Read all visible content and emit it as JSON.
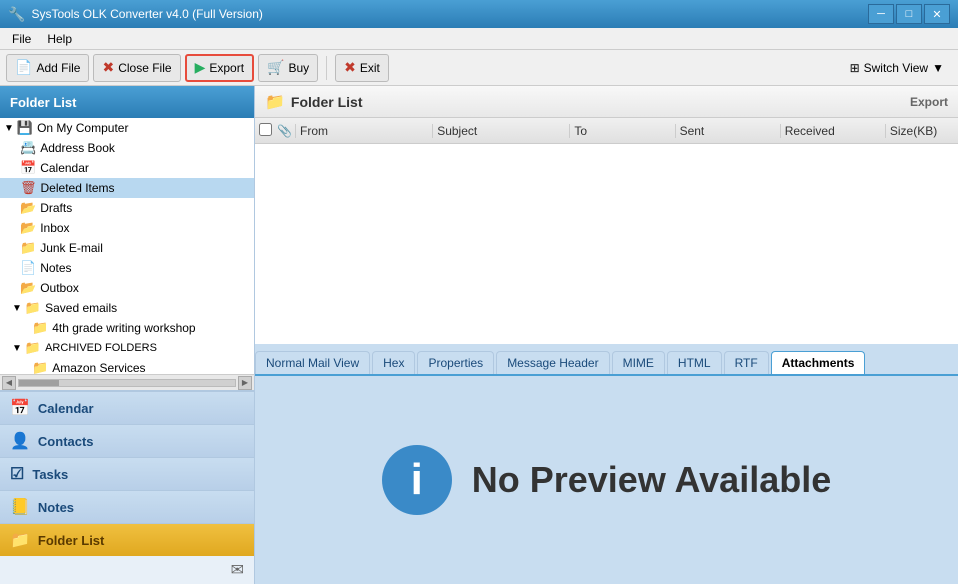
{
  "titleBar": {
    "title": "SysTools OLK Converter v4.0 (Full Version)",
    "controls": {
      "minimize": "─",
      "maximize": "□",
      "close": "✕"
    }
  },
  "menuBar": {
    "items": [
      "File",
      "Help"
    ]
  },
  "toolbar": {
    "addFile": "Add File",
    "closeFile": "Close File",
    "export": "Export",
    "buy": "Buy",
    "exit": "Exit",
    "switchView": "Switch View"
  },
  "sidebar": {
    "header": "Folder List",
    "tree": [
      {
        "id": "on-my-computer",
        "label": "On My Computer",
        "indent": 0,
        "type": "root",
        "expanded": true
      },
      {
        "id": "address-book",
        "label": "Address Book",
        "indent": 1,
        "type": "contacts"
      },
      {
        "id": "calendar",
        "label": "Calendar",
        "indent": 1,
        "type": "calendar"
      },
      {
        "id": "deleted-items",
        "label": "Deleted Items",
        "indent": 1,
        "type": "trash"
      },
      {
        "id": "drafts",
        "label": "Drafts",
        "indent": 1,
        "type": "folder"
      },
      {
        "id": "inbox",
        "label": "Inbox",
        "indent": 1,
        "type": "folder"
      },
      {
        "id": "junk-email",
        "label": "Junk E-mail",
        "indent": 1,
        "type": "junk"
      },
      {
        "id": "notes",
        "label": "Notes",
        "indent": 1,
        "type": "notes"
      },
      {
        "id": "outbox",
        "label": "Outbox",
        "indent": 1,
        "type": "folder"
      },
      {
        "id": "saved-emails",
        "label": "Saved emails",
        "indent": 1,
        "type": "root",
        "expanded": true
      },
      {
        "id": "grade-writing",
        "label": "4th grade writing workshop",
        "indent": 2,
        "type": "folder"
      },
      {
        "id": "archived-folders",
        "label": "ARCHIVED FOLDERS",
        "indent": 1,
        "type": "root",
        "expanded": true
      },
      {
        "id": "amazon-services",
        "label": "Amazon Services",
        "indent": 2,
        "type": "folder"
      }
    ],
    "bottomNav": [
      {
        "id": "calendar",
        "label": "Calendar",
        "icon": "📅",
        "active": false
      },
      {
        "id": "contacts",
        "label": "Contacts",
        "icon": "👤",
        "active": false
      },
      {
        "id": "tasks",
        "label": "Tasks",
        "icon": "☑",
        "active": false
      },
      {
        "id": "notes",
        "label": "Notes",
        "icon": "📒",
        "active": false
      },
      {
        "id": "folder-list",
        "label": "Folder List",
        "icon": "📁",
        "active": true
      }
    ]
  },
  "rightPanel": {
    "folderListHeader": "Folder List",
    "exportLabel": "Export",
    "emailTable": {
      "columns": [
        "",
        "",
        "From",
        "Subject",
        "To",
        "Sent",
        "Received",
        "Size(KB)"
      ]
    },
    "tabs": [
      {
        "id": "normal-mail",
        "label": "Normal Mail View",
        "active": false
      },
      {
        "id": "hex",
        "label": "Hex",
        "active": false
      },
      {
        "id": "properties",
        "label": "Properties",
        "active": false
      },
      {
        "id": "message-header",
        "label": "Message Header",
        "active": false
      },
      {
        "id": "mime",
        "label": "MIME",
        "active": false
      },
      {
        "id": "html",
        "label": "HTML",
        "active": false
      },
      {
        "id": "rtf",
        "label": "RTF",
        "active": false
      },
      {
        "id": "attachments",
        "label": "Attachments",
        "active": true
      }
    ],
    "preview": {
      "icon": "i",
      "text": "No Preview Available"
    }
  }
}
